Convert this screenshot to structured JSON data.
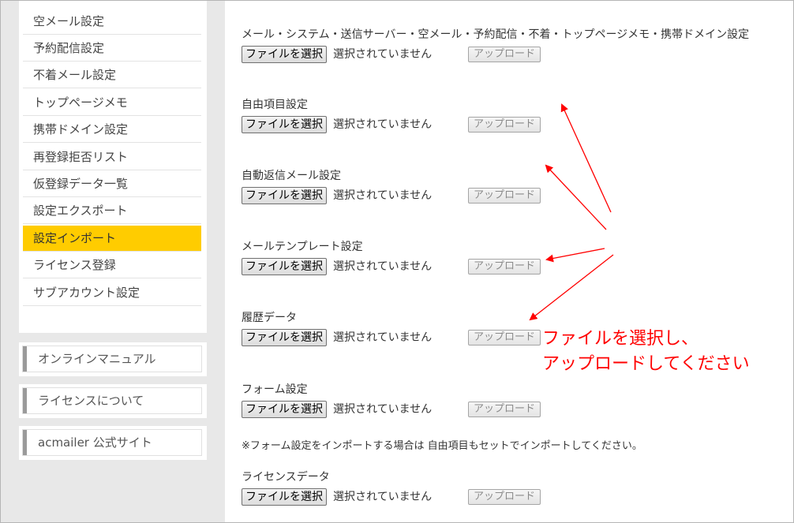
{
  "sidebar": {
    "items": [
      {
        "label": "空メール設定"
      },
      {
        "label": "予約配信設定"
      },
      {
        "label": "不着メール設定"
      },
      {
        "label": "トップページメモ"
      },
      {
        "label": "携帯ドメイン設定"
      },
      {
        "label": "再登録拒否リスト"
      },
      {
        "label": "仮登録データ一覧"
      },
      {
        "label": "設定エクスポート"
      },
      {
        "label": "設定インポート",
        "active": true
      },
      {
        "label": "ライセンス登録"
      },
      {
        "label": "サブアカウント設定"
      }
    ],
    "links": [
      {
        "label": "オンラインマニュアル"
      },
      {
        "label": "ライセンスについて"
      },
      {
        "label": "acmailer 公式サイト"
      }
    ],
    "active_color": "#ffcc00"
  },
  "import": {
    "choose_label": "ファイルを選択",
    "no_file_label": "選択されていません",
    "upload_label": "アップロード",
    "sections": [
      {
        "title": "メール・システム・送信サーバー・空メール・予約配信・不着・トップページメモ・携帯ドメイン設定"
      },
      {
        "title": "自由項目設定"
      },
      {
        "title": "自動返信メール設定"
      },
      {
        "title": "メールテンプレート設定"
      },
      {
        "title": "履歴データ"
      },
      {
        "title": "フォーム設定"
      },
      {
        "title": "ライセンスデータ"
      }
    ],
    "note": "※フォーム設定をインポートする場合は 自由項目もセットでインポートしてください。"
  },
  "annotation": {
    "line1": "ファイルを選択し、",
    "line2": "アップロードしてください",
    "color": "#ff0000"
  }
}
